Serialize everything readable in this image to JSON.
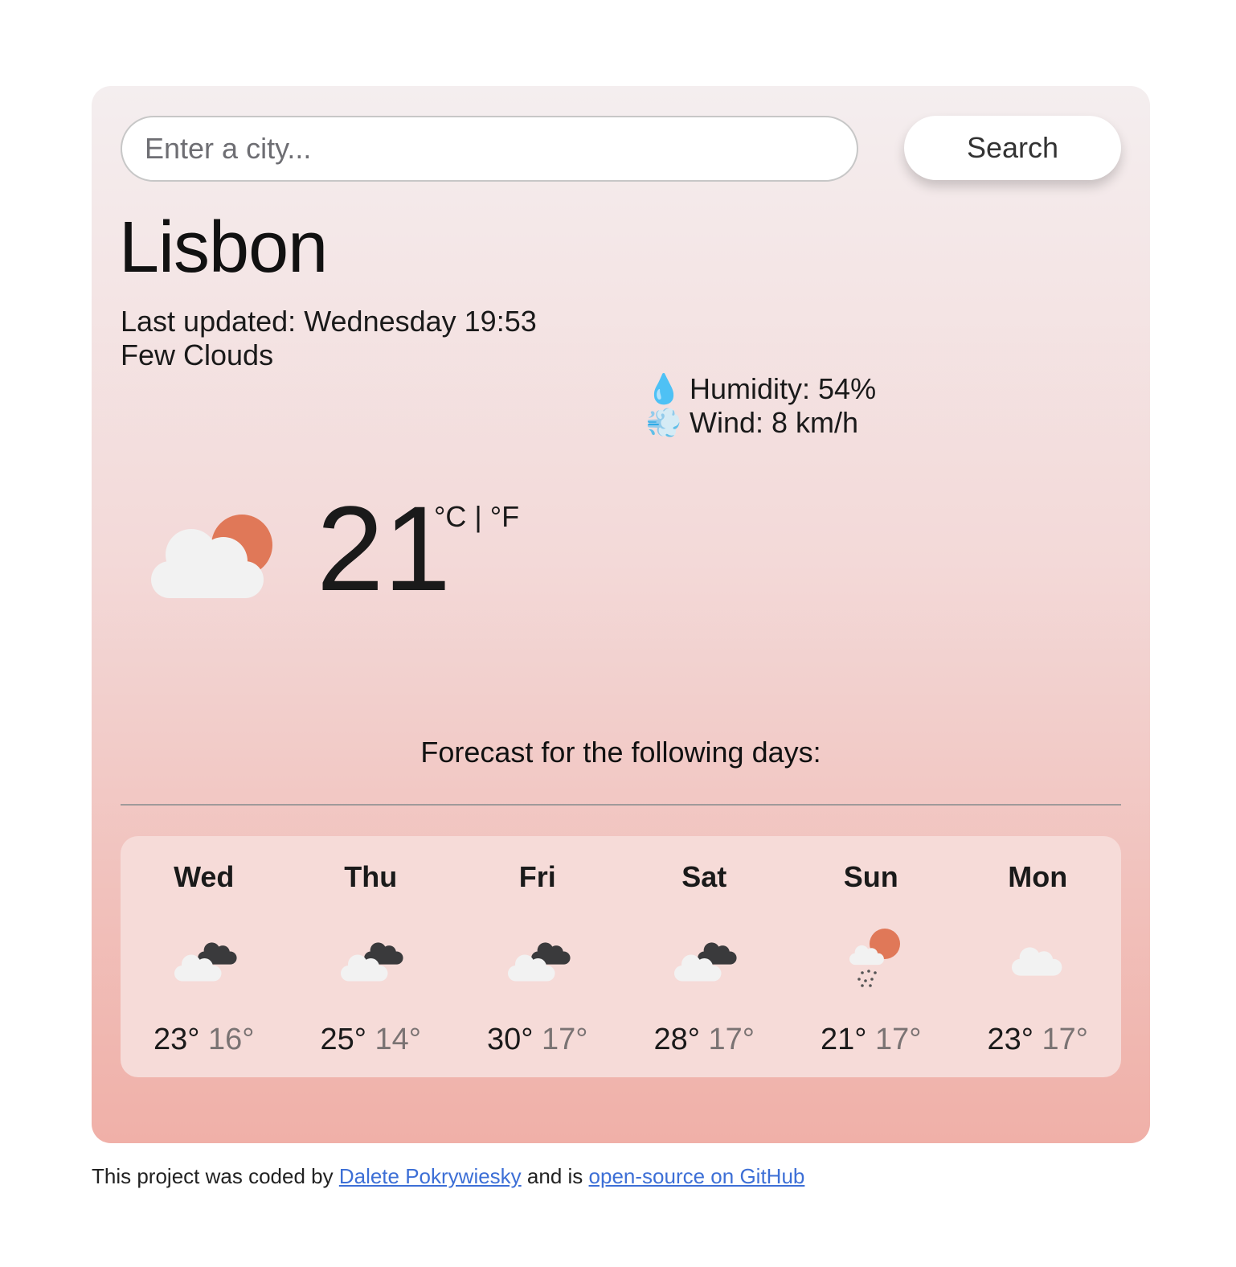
{
  "search": {
    "placeholder": "Enter a city...",
    "button_label": "Search"
  },
  "current": {
    "city": "Lisbon",
    "last_updated_label": "Last updated:",
    "last_updated": "Wednesday 19:53",
    "description": "Few Clouds",
    "humidity_text": "Humidity: 54%",
    "wind_text": "Wind: 8 km/h",
    "humidity_icon": "💧",
    "wind_icon": "💨",
    "temperature": "21",
    "units": "°C | °F",
    "icon": "few-clouds-day"
  },
  "forecast": {
    "title": "Forecast for the following days:",
    "days": [
      {
        "name": "Wed",
        "max": "23°",
        "min": "16°",
        "icon": "broken-clouds"
      },
      {
        "name": "Thu",
        "max": "25°",
        "min": "14°",
        "icon": "broken-clouds"
      },
      {
        "name": "Fri",
        "max": "30°",
        "min": "17°",
        "icon": "broken-clouds"
      },
      {
        "name": "Sat",
        "max": "28°",
        "min": "17°",
        "icon": "broken-clouds"
      },
      {
        "name": "Sun",
        "max": "21°",
        "min": "17°",
        "icon": "rain-day"
      },
      {
        "name": "Mon",
        "max": "23°",
        "min": "17°",
        "icon": "cloud"
      }
    ]
  },
  "footer": {
    "prefix": "This project was coded by",
    "author": "Dalete Pokrywiesky",
    "middle": "and is",
    "repo_link": "open-source on GitHub"
  },
  "colors": {
    "sun": "#e07858",
    "cloud_light": "#f2f2f2",
    "cloud_dark": "#3a3a3c",
    "rain": "#555555",
    "link": "#3d6fd6"
  }
}
